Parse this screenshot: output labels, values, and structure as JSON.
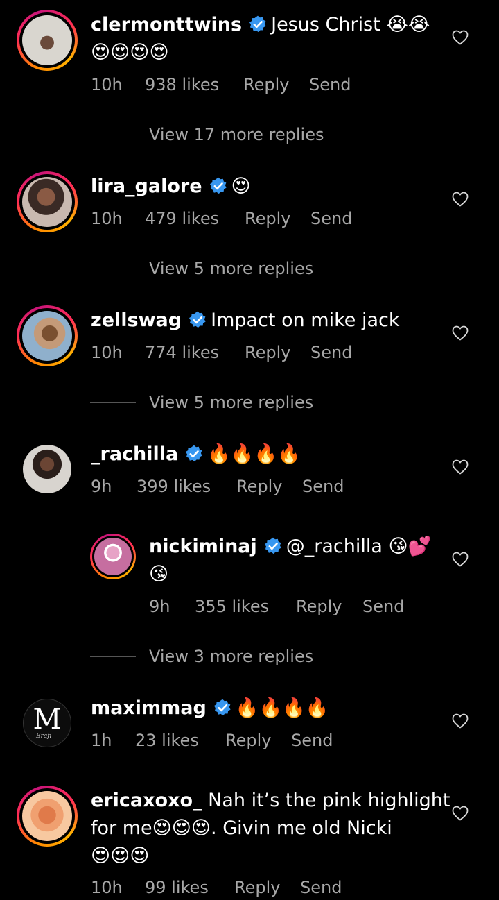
{
  "comments": [
    {
      "username": "clermonttwins",
      "text": "Jesus Christ 😭😭",
      "text2": "😍😍😍😍",
      "time": "10h",
      "likes": "938 likes",
      "reply": "Reply",
      "send": "Send",
      "view_more": "View 17 more replies"
    },
    {
      "username": "lira_galore",
      "text": "😍",
      "time": "10h",
      "likes": "479 likes",
      "reply": "Reply",
      "send": "Send",
      "view_more": "View 5 more replies"
    },
    {
      "username": "zellswag",
      "text": "Impact on mike jack",
      "time": "10h",
      "likes": "774 likes",
      "reply": "Reply",
      "send": "Send",
      "view_more": "View 5 more replies"
    },
    {
      "username": "_rachilla",
      "text": "🔥🔥🔥🔥",
      "time": "9h",
      "likes": "399 likes",
      "reply": "Reply",
      "send": "Send"
    },
    {
      "username": "nickiminaj",
      "text": "@_rachilla 😘💕",
      "text2": "😘",
      "time": "9h",
      "likes": "355 likes",
      "reply": "Reply",
      "send": "Send",
      "view_more": "View 3 more replies"
    },
    {
      "username": "maximmag",
      "avatar_letter": "M",
      "avatar_script": "Brafi",
      "text": "🔥🔥🔥🔥",
      "time": "1h",
      "likes": "23 likes",
      "reply": "Reply",
      "send": "Send"
    },
    {
      "username": "ericaxoxo_",
      "text": "Nah it’s the pink highlight",
      "text2": "for me😍😍😍. Givin me old Nicki",
      "text3": "😍😍😍",
      "time": "10h",
      "likes": "99 likes",
      "reply": "Reply",
      "send": "Send"
    }
  ],
  "colors": {
    "verified": "#3897f0",
    "secondary_text": "#a8a8a8",
    "background": "#000000"
  },
  "icons": {
    "verified": "verified-badge-icon",
    "like": "heart-outline-icon"
  }
}
